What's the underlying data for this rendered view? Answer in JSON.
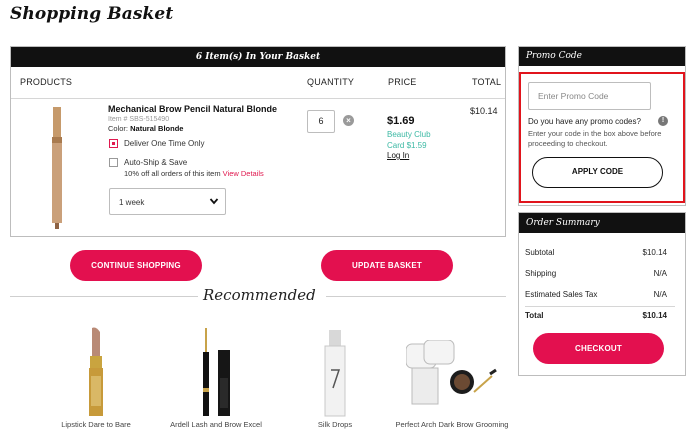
{
  "page": {
    "title": "Shopping Basket"
  },
  "basket": {
    "header": "6 Item(s) In Your Basket",
    "columns": {
      "products": "PRODUCTS",
      "quantity": "QUANTITY",
      "price": "PRICE",
      "total": "TOTAL"
    },
    "item": {
      "name": "Mechanical Brow Pencil Natural Blonde",
      "item_number": "Item # SBS-515490",
      "color_label": "Color:",
      "color_value": "Natural Blonde",
      "deliver_label": "Deliver One Time Only",
      "deliver_checked": true,
      "autoship_label": "Auto-Ship & Save",
      "autoship_checked": false,
      "autoship_note": "10% off all orders of this item",
      "view_details": "View Details",
      "frequency": "1 week",
      "quantity": "6",
      "price": "$1.69",
      "club_price": "Beauty Club Card $1.59",
      "login": "Log In",
      "total": "$10.14"
    },
    "continue_label": "CONTINUE SHOPPING",
    "update_label": "UPDATE BASKET"
  },
  "recommended": {
    "title": "Recommended",
    "items": [
      {
        "name": "Lipstick Dare to Bare"
      },
      {
        "name": "Ardell Lash and Brow Excel"
      },
      {
        "name": "Silk Drops"
      },
      {
        "name": "Perfect Arch Dark Brow Grooming"
      }
    ]
  },
  "promo": {
    "header": "Promo Code",
    "placeholder": "Enter Promo Code",
    "question": "Do you have any promo codes?",
    "instructions": "Enter your code in the box above before proceeding to checkout.",
    "apply_label": "APPLY CODE"
  },
  "summary": {
    "header": "Order Summary",
    "rows": [
      {
        "label": "Subtotal",
        "value": "$10.14"
      },
      {
        "label": "Shipping",
        "value": "N/A"
      },
      {
        "label": "Estimated Sales Tax",
        "value": "N/A"
      },
      {
        "label": "Total",
        "value": "$10.14"
      }
    ],
    "checkout_label": "CHECKOUT"
  },
  "colors": {
    "accent": "#e3104f",
    "header_bg": "#111111",
    "club_price": "#3cb9a4",
    "highlight": "#e1141c"
  }
}
